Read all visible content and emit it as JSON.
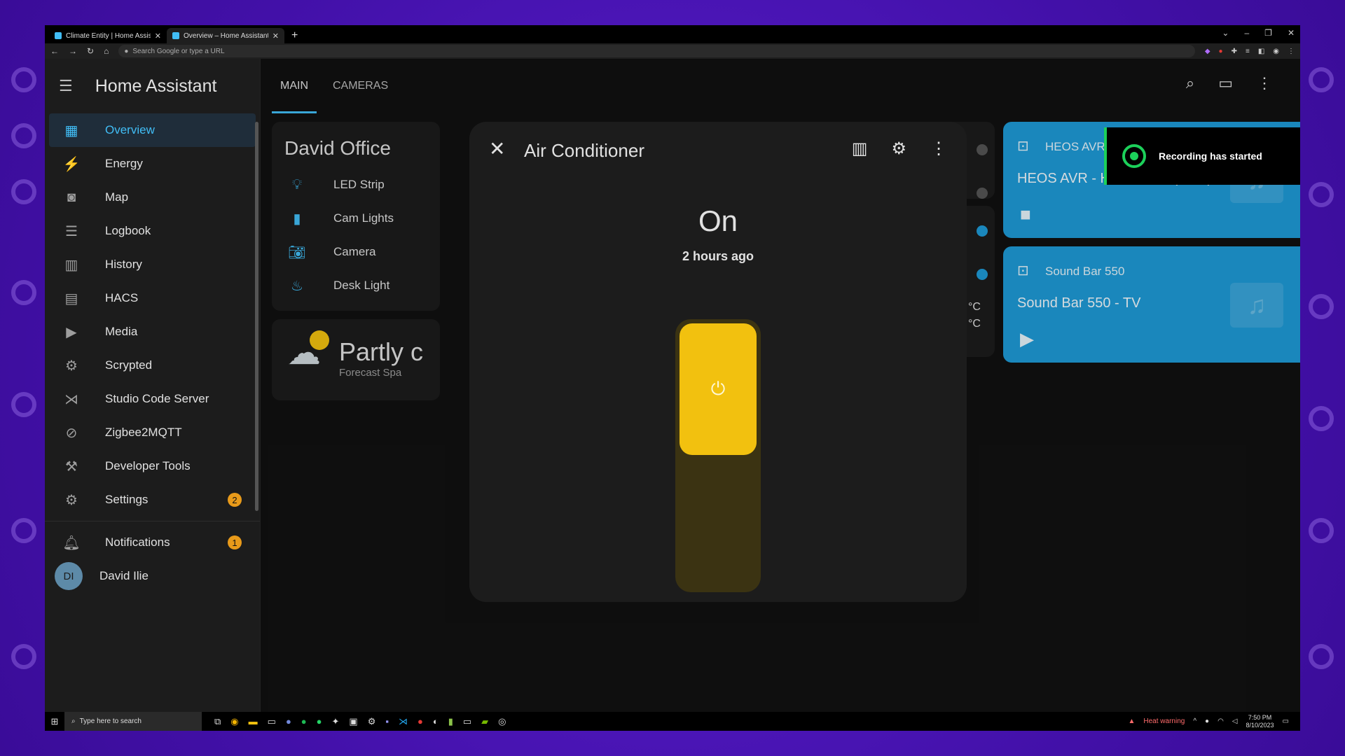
{
  "browser": {
    "tabs": [
      {
        "label": "Climate Entity | Home Assistant",
        "active": false
      },
      {
        "label": "Overview – Home Assistant",
        "active": true
      }
    ],
    "new_tab": "+",
    "address_placeholder": "Search Google or type a URL"
  },
  "sidebar": {
    "title": "Home Assistant",
    "items": [
      {
        "label": "Overview",
        "icon": "dashboard-icon",
        "active": true
      },
      {
        "label": "Energy",
        "icon": "lightning-icon"
      },
      {
        "label": "Map",
        "icon": "map-icon"
      },
      {
        "label": "Logbook",
        "icon": "logbook-icon"
      },
      {
        "label": "History",
        "icon": "history-icon"
      },
      {
        "label": "HACS",
        "icon": "hacs-icon"
      },
      {
        "label": "Media",
        "icon": "media-icon"
      },
      {
        "label": "Scrypted",
        "icon": "chip-icon"
      },
      {
        "label": "Studio Code Server",
        "icon": "vscode-icon"
      },
      {
        "label": "Zigbee2MQTT",
        "icon": "zigbee-icon"
      },
      {
        "label": "Developer Tools",
        "icon": "hammer-icon"
      },
      {
        "label": "Settings",
        "icon": "gear-icon",
        "badge": "2"
      }
    ],
    "notifications": {
      "label": "Notifications",
      "badge": "1"
    },
    "user": {
      "initials": "DI",
      "name": "David Ilie"
    }
  },
  "header": {
    "tabs": [
      "MAIN",
      "CAMERAS"
    ],
    "active_tab": "MAIN"
  },
  "office_card": {
    "title": "David Office",
    "entities": [
      {
        "label": "LED Strip",
        "icon": "bulb-icon"
      },
      {
        "label": "Cam Lights",
        "icon": "switch-icon"
      },
      {
        "label": "Camera",
        "icon": "camera-icon"
      },
      {
        "label": "Desk Light",
        "icon": "desk-lamp-icon"
      }
    ]
  },
  "weather_card": {
    "condition": "Partly c",
    "subtitle": "Forecast Spa"
  },
  "temp_units": [
    "°C",
    "°C"
  ],
  "media_players": [
    {
      "name": "HEOS AVR",
      "title": "HEOS AVR - HDMI OUT (ARC)",
      "control": "stop"
    },
    {
      "name": "Sound Bar 550",
      "title": "Sound Bar 550 - TV",
      "control": "play"
    }
  ],
  "dialog": {
    "title": "Air Conditioner",
    "state": "On",
    "last_changed": "2 hours ago",
    "toggle_on": true,
    "accent": "#f2c10f"
  },
  "toast": {
    "text": "Recording has started"
  },
  "taskbar": {
    "search_placeholder": "Type here to search",
    "heat_warning": "Heat warning",
    "time": "7:50 PM",
    "date": "8/10/2023"
  },
  "colors": {
    "primary": "#41bdf5",
    "media_card": "#1e9ad6",
    "badge": "#e89a1a",
    "toast_accent": "#1cd05a"
  }
}
